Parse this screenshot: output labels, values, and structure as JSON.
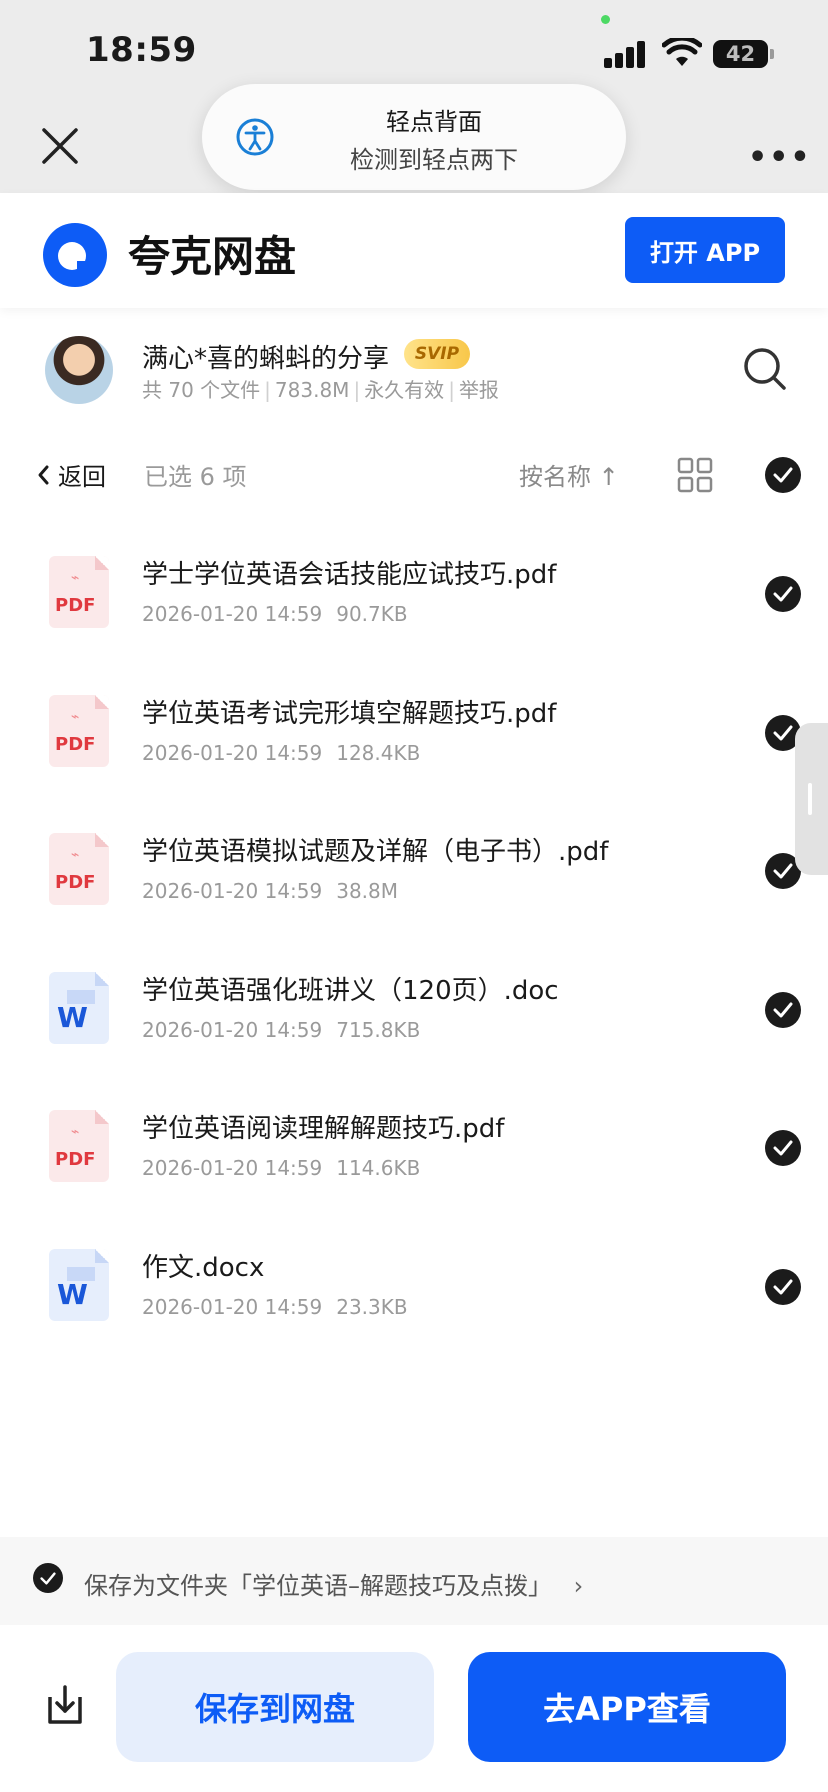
{
  "status_bar": {
    "time": "18:59",
    "battery": "42"
  },
  "browser": {
    "close_icon": "close-icon",
    "more_label": "•••"
  },
  "notification": {
    "icon": "accessibility-icon",
    "title": "轻点背面",
    "subtitle": "检测到轻点两下"
  },
  "header": {
    "app_name": "夸克网盘",
    "open_app_label": "打开 APP",
    "brand_color": "#0d5cf6"
  },
  "sharer": {
    "name": "满心*喜的蝌蚪的分享",
    "badge": "SVIP",
    "file_count": "共 70 个文件",
    "total_size": "783.8M",
    "validity": "永久有效",
    "report_label": "举报"
  },
  "toolbar": {
    "back_label": "返回",
    "selected_label": "已选 6 项",
    "sort_label": "按名称 ↑"
  },
  "files": [
    {
      "type": "pdf",
      "name": "学士学位英语会话技能应试技巧.pdf",
      "date": "2026-01-20 14:59",
      "size": "90.7KB"
    },
    {
      "type": "pdf",
      "name": "学位英语考试完形填空解题技巧.pdf",
      "date": "2026-01-20 14:59",
      "size": "128.4KB"
    },
    {
      "type": "pdf",
      "name": "学位英语模拟试题及详解（电子书）.pdf",
      "date": "2026-01-20 14:59",
      "size": "38.8M"
    },
    {
      "type": "doc",
      "name": "学位英语强化班讲义（120页）.doc",
      "date": "2026-01-20 14:59",
      "size": "715.8KB"
    },
    {
      "type": "pdf",
      "name": "学位英语阅读理解解题技巧.pdf",
      "date": "2026-01-20 14:59",
      "size": "114.6KB"
    },
    {
      "type": "doc",
      "name": "作文.docx",
      "date": "2026-01-20 14:59",
      "size": "23.3KB"
    }
  ],
  "file_icon_labels": {
    "pdf": "PDF",
    "doc": "W"
  },
  "save_folder": {
    "text": "保存为文件夹「学位英语–解题技巧及点拨」",
    "chevron": "›"
  },
  "actions": {
    "save_label": "保存到网盘",
    "view_app_label": "去APP查看"
  }
}
